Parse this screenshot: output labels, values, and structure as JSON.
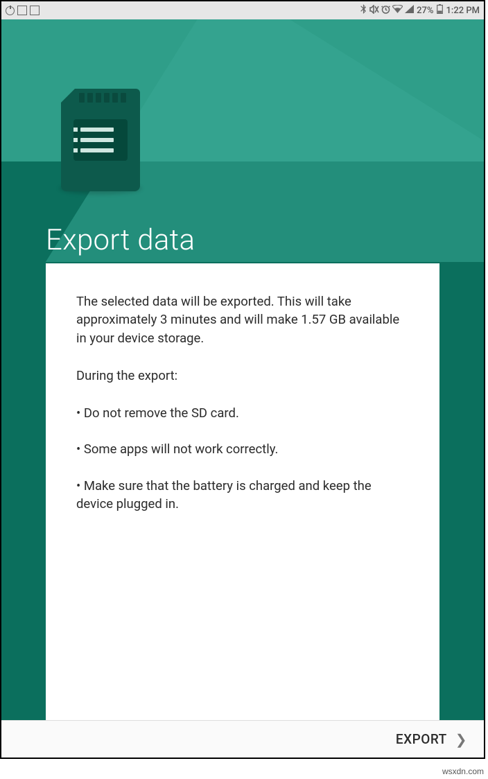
{
  "status_bar": {
    "battery_percent": "27%",
    "clock": "1:22 PM"
  },
  "page": {
    "title": "Export data"
  },
  "card": {
    "intro": "The selected data will be exported. This will take approximately 3 minutes and will make 1.57 GB available in your device storage.",
    "during_heading": "During the export:",
    "bullet1": "• Do not remove the SD card.",
    "bullet2": "• Some apps will not work correctly.",
    "bullet3": "• Make sure that the battery is charged and keep the device plugged in."
  },
  "bottom": {
    "export_label": "EXPORT"
  },
  "watermark": "wsxdn.com"
}
